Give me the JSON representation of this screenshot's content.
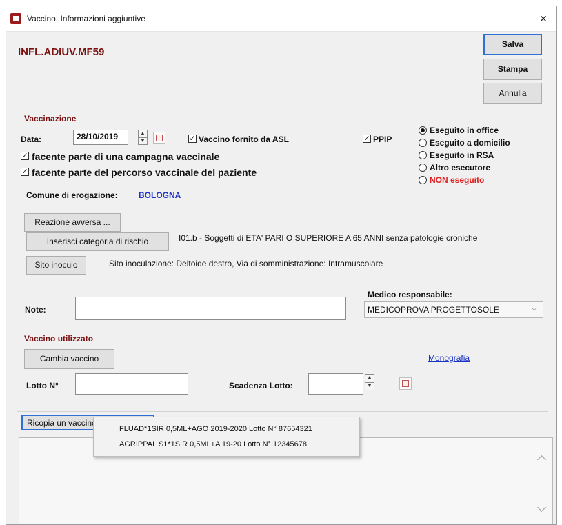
{
  "window": {
    "title": "Vaccino. Informazioni aggiuntive",
    "close_glyph": "×",
    "app_icon": "castle-tower-icon"
  },
  "header": {
    "code": "INFL.ADIUV.MF59",
    "code_color": "#7a1010"
  },
  "actions": {
    "save": "Salva",
    "print": "Stampa",
    "cancel": "Annulla"
  },
  "vaccinazione": {
    "title": "Vaccinazione",
    "date_label": "Data:",
    "date_value": "28/10/2019",
    "asl_label": "Vaccino fornito da ASL",
    "asl_checked": true,
    "ppip_label": "PPIP",
    "ppip_checked": true,
    "campaign_label": "facente parte di una campagna vaccinale",
    "campaign_checked": true,
    "path_label": "facente parte del percorso vaccinale del paziente",
    "path_checked": true,
    "execution": {
      "options": [
        {
          "label": "Eseguito in office",
          "selected": true,
          "color": "#111111"
        },
        {
          "label": "Eseguito a domicilio",
          "selected": false,
          "color": "#111111"
        },
        {
          "label": "Eseguito in RSA",
          "selected": false,
          "color": "#111111"
        },
        {
          "label": "Altro esecutore",
          "selected": false,
          "color": "#111111"
        },
        {
          "label": "NON eseguito",
          "selected": false,
          "color": "#e02020"
        }
      ]
    },
    "comune_label": "Comune di erogazione:",
    "comune_value": "BOLOGNA",
    "reaction_button": "Reazione avversa ...",
    "risk_button": "Inserisci categoria di rischio",
    "risk_text": "I01.b  - Soggetti di ETA' PARI  O SUPERIORE A 65 ANNI senza patologie croniche",
    "site_button": "Sito inoculo",
    "site_text": "Sito inoculazione: Deltoide destro, Via di somministrazione: Intramuscolare",
    "notes_label": "Note:",
    "notes_value": "",
    "doctor_label": "Medico responsabile:",
    "doctor_value": "MEDICOPROVA PROGETTOSOLE"
  },
  "vaccino": {
    "title": "Vaccino utilizzato",
    "change_button": "Cambia vaccino",
    "monograph_link": "Monografia",
    "lot_label": "Lotto N°",
    "lot_value": "",
    "expiry_label": "Scadenza Lotto:",
    "expiry_value": "",
    "copy_button": "Ricopia un vaccino e lotto..."
  },
  "copy_menu": {
    "items": [
      "FLUAD*1SIR 0,5ML+AGO 2019-2020 Lotto N° 87654321",
      "AGRIPPAL S1*1SIR 0,5ML+A 19-20 Lotto N° 12345678"
    ]
  }
}
